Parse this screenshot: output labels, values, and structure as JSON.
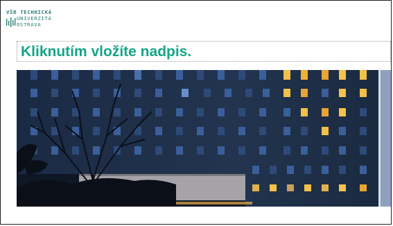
{
  "logo": {
    "line1_school": "VŠB",
    "line1_rest": "TECHNICKÁ",
    "line2": "UNIVERZITA",
    "line3": "OSTRAVA"
  },
  "slide": {
    "title_placeholder": "Kliknutím vložíte nadpis."
  },
  "photo": {
    "icon": "building-photo"
  },
  "colors": {
    "brand_teal": "#16a589",
    "logo_teal": "#2f7f74"
  }
}
